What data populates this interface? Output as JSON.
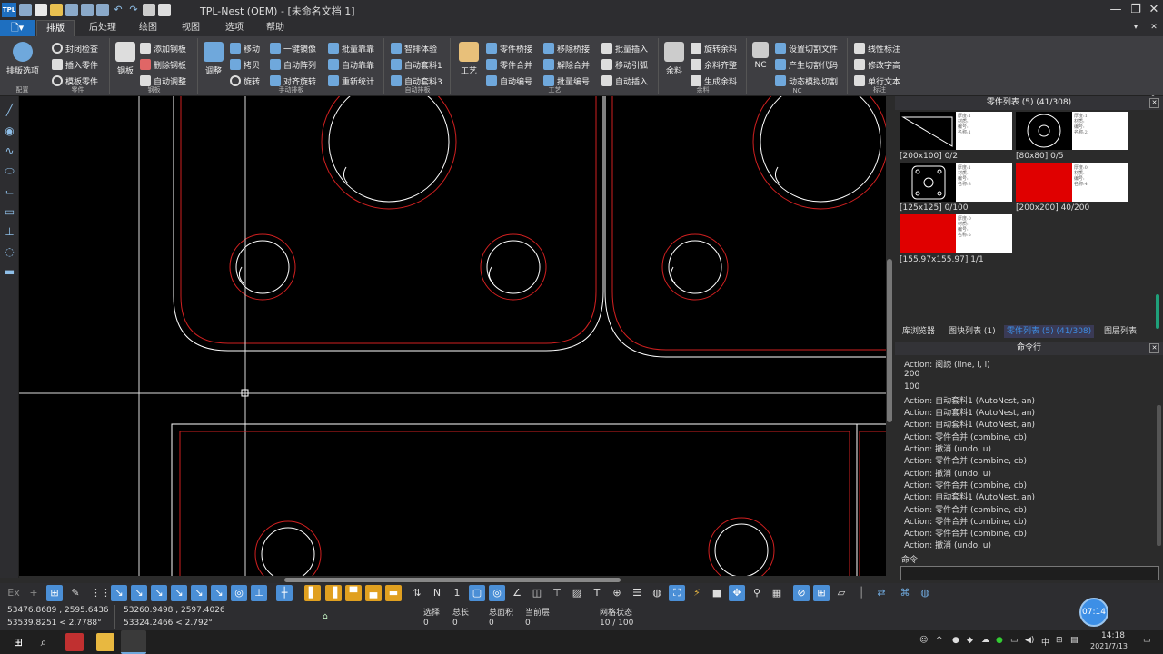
{
  "app": {
    "title": "TPL-Nest (OEM) - [未命名文档 1]",
    "logo": "TPL",
    "window_controls": [
      "—",
      "❐",
      "✕"
    ]
  },
  "menu": {
    "file_icon": "file-icon",
    "tabs": [
      "排版",
      "后处理",
      "绘图",
      "视图",
      "选项",
      "帮助"
    ],
    "active_tab": "排版"
  },
  "ribbon": {
    "groups": {
      "config": {
        "label": "排版选项",
        "name": "配置"
      },
      "part": {
        "items": [
          "封闭检查",
          "插入零件",
          "模板零件"
        ],
        "name": "零件"
      },
      "sheet": {
        "big": "钢板",
        "items": [
          "添加钢板",
          "删除钢板",
          "自动调整"
        ],
        "name": "钢板"
      },
      "manual": {
        "big": "调整",
        "items": [
          "移动",
          "拷贝",
          "旋转",
          "一键镜像",
          "自动阵列",
          "对齐旋转",
          "批量靠靠",
          "自动靠靠",
          "重新统计"
        ],
        "name": "手动排板"
      },
      "auto": {
        "items": [
          "智排体验",
          "自动套料1",
          "自动套料3"
        ],
        "name": "自动排板"
      },
      "process": {
        "big": "工艺",
        "items": [
          "零件桥接",
          "零件合并",
          "自动编号",
          "移除桥接",
          "解除合并",
          "批量编号",
          "批量插入",
          "移动引弧",
          "自动插入"
        ],
        "name": "工艺"
      },
      "remnant": {
        "big": "余料",
        "items": [
          "旋转余料",
          "余料齐整",
          "生成余料"
        ],
        "name": "余料"
      },
      "nc": {
        "big": "NC",
        "items": [
          "设置切割文件",
          "产生切割代码",
          "动态模拟切割"
        ],
        "name": "NC"
      },
      "mark": {
        "items": [
          "线性标注",
          "修改字高",
          "单行文本"
        ],
        "name": "标注"
      }
    }
  },
  "parts_panel": {
    "title": "零件列表 (5) (41/308)",
    "cards": [
      {
        "label": "[200x100] 0/2",
        "meta": [
          "厚度:1",
          "材质:",
          "编号:",
          "名称:1"
        ]
      },
      {
        "label": "[80x80] 0/5",
        "meta": [
          "厚度:1",
          "材质:",
          "编号:",
          "名称:2"
        ]
      },
      {
        "label": "[125x125] 0/100",
        "meta": [
          "厚度:1",
          "材质:",
          "编号:",
          "名称:3"
        ]
      },
      {
        "label": "[200x200] 40/200",
        "meta": [
          "厚度:0",
          "材质:",
          "编号:",
          "名称:4"
        ]
      },
      {
        "label": "[155.97x155.97] 1/1",
        "meta": [
          "厚度:0",
          "材质:",
          "编号:",
          "名称:5"
        ]
      }
    ],
    "tabs": [
      "库浏览器",
      "图块列表 (1)",
      "零件列表 (5) (41/308)",
      "图层列表"
    ],
    "active_tab": "零件列表 (5) (41/308)"
  },
  "command": {
    "title": "命令行",
    "log": [
      "Action: 阅読 (line, l, l)",
      "200",
      "100",
      "Action: 自动套料1 (AutoNest, an)",
      "Action: 自动套料1 (AutoNest, an)",
      "Action: 自动套料1 (AutoNest, an)",
      "Action: 零件合并 (combine, cb)",
      "Action: 撤消 (undo, u)",
      "Action: 零件合并 (combine, cb)",
      "Action: 撤消 (undo, u)",
      "Action: 零件合并 (combine, cb)",
      "Action: 自动套料1 (AutoNest, an)",
      "Action: 零件合并 (combine, cb)",
      "Action: 零件合并 (combine, cb)",
      "Action: 零件合并 (combine, cb)",
      "Action: 撤消 (undo, u)"
    ],
    "prompt": "命令:",
    "input": ""
  },
  "status": {
    "coord1": "53476.8689 , 2595.6436",
    "coord2": "53539.8251 < 2.7788°",
    "coord3": "53260.9498 , 2597.4026",
    "coord4": "53324.2466 < 2.792°",
    "select_label": "选择",
    "select_value": "0",
    "total_len_label": "总长",
    "total_len_value": "0",
    "total_area_label": "总面积",
    "total_area_value": "0",
    "layer_label": "当前层",
    "layer_value": "0",
    "grid_label": "网格状态",
    "grid_value": "10 / 100",
    "bubble_time": "07:14"
  },
  "taskbar": {
    "time": "14:18",
    "date": "2021/7/13",
    "ime": "中"
  },
  "colors": {
    "accent": "#1e6fc0",
    "part_outline": "#ffffff",
    "kerf": "#d02020"
  }
}
